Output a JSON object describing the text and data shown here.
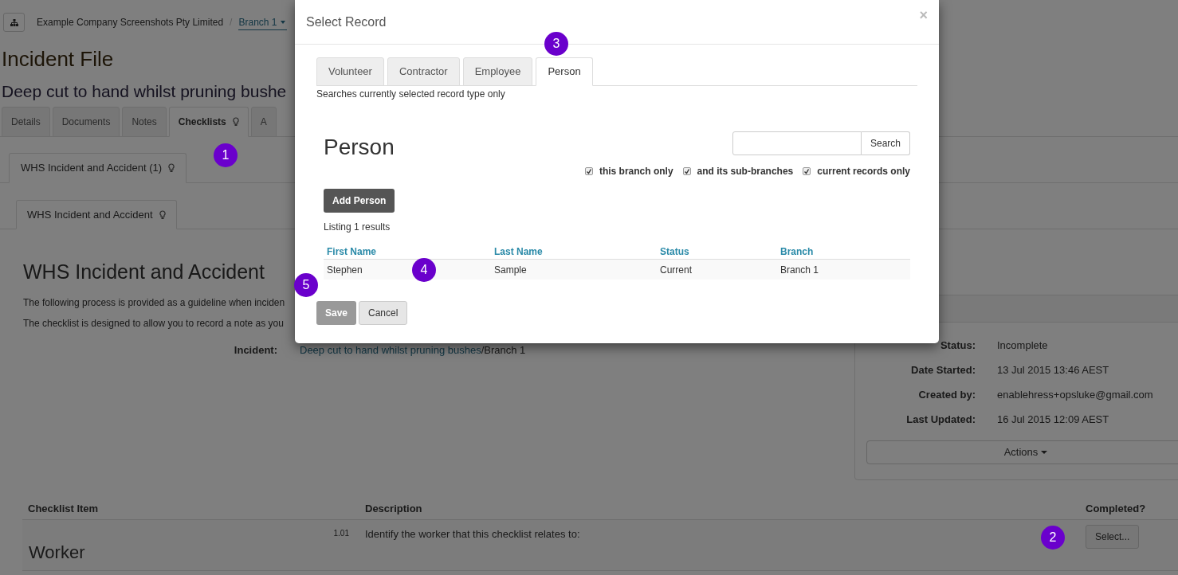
{
  "breadcrumb": {
    "company": "Example Company Screenshots Pty Limited",
    "separator": "/",
    "branch": "Branch 1"
  },
  "page_title": "Incident File",
  "incident_title": "Deep cut to hand whilst pruning bushe",
  "tabs": [
    {
      "label": "Details",
      "selected": false,
      "hint": false
    },
    {
      "label": "Documents",
      "selected": false,
      "hint": false
    },
    {
      "label": "Notes",
      "selected": false,
      "hint": false
    },
    {
      "label": "Checklists",
      "selected": true,
      "hint": true
    },
    {
      "label": "A",
      "selected": false,
      "hint": false
    }
  ],
  "checklist_tab": {
    "label": "WHS Incident and Accident (1)"
  },
  "checklist_subtab": {
    "label": "WHS Incident and Accident"
  },
  "checklist": {
    "heading": "WHS Incident and Accident",
    "paragraphs": [
      "The following process is provided as a guideline when inciden",
      "The checklist is designed to allow you to record a note as you"
    ],
    "incident_label": "Incident:",
    "incident_link": "Deep cut to hand whilst pruning bushes",
    "incident_branch": "/Branch 1"
  },
  "details_panel": {
    "fields": [
      {
        "label": "Status:",
        "value": "Incomplete"
      },
      {
        "label": "Date Started:",
        "value": "13 Jul 2015 13:46 AEST"
      },
      {
        "label": "Created by:",
        "value": "enablehress+opsluke@gmail.com"
      },
      {
        "label": "Last Updated:",
        "value": "16 Jul 2015 12:09 AEST"
      }
    ],
    "actions_button": "Actions"
  },
  "checklist_table": {
    "columns": [
      "Checklist Item",
      "Description",
      "Completed?"
    ],
    "rows": [
      {
        "number": "1.01",
        "item": "Worker",
        "description": "Identify the worker that this checklist relates to:",
        "button": "Select..."
      }
    ]
  },
  "modal": {
    "title": "Select Record",
    "close": "×",
    "tabs": [
      {
        "label": "Volunteer",
        "selected": false
      },
      {
        "label": "Contractor",
        "selected": false
      },
      {
        "label": "Employee",
        "selected": false
      },
      {
        "label": "Person",
        "selected": true
      }
    ],
    "hint": "Searches currently selected record type only",
    "heading": "Person",
    "search_button": "Search",
    "filters": [
      {
        "label": "this branch only",
        "checked": true
      },
      {
        "label": "and its sub-branches",
        "checked": true
      },
      {
        "label": "current records only",
        "checked": true
      }
    ],
    "add_button": "Add Person",
    "result_count": "Listing 1 results",
    "columns": [
      "First Name",
      "Last Name",
      "Status",
      "Branch"
    ],
    "rows": [
      {
        "cells": [
          "Stephen",
          "Sample",
          "Current",
          "Branch 1"
        ]
      }
    ],
    "save_button": {
      "label": "Save",
      "disabled": true
    },
    "cancel_button": "Cancel"
  },
  "callouts": [
    {
      "label": "1"
    },
    {
      "label": "2"
    },
    {
      "label": "3"
    },
    {
      "label": "4"
    },
    {
      "label": "5"
    }
  ]
}
